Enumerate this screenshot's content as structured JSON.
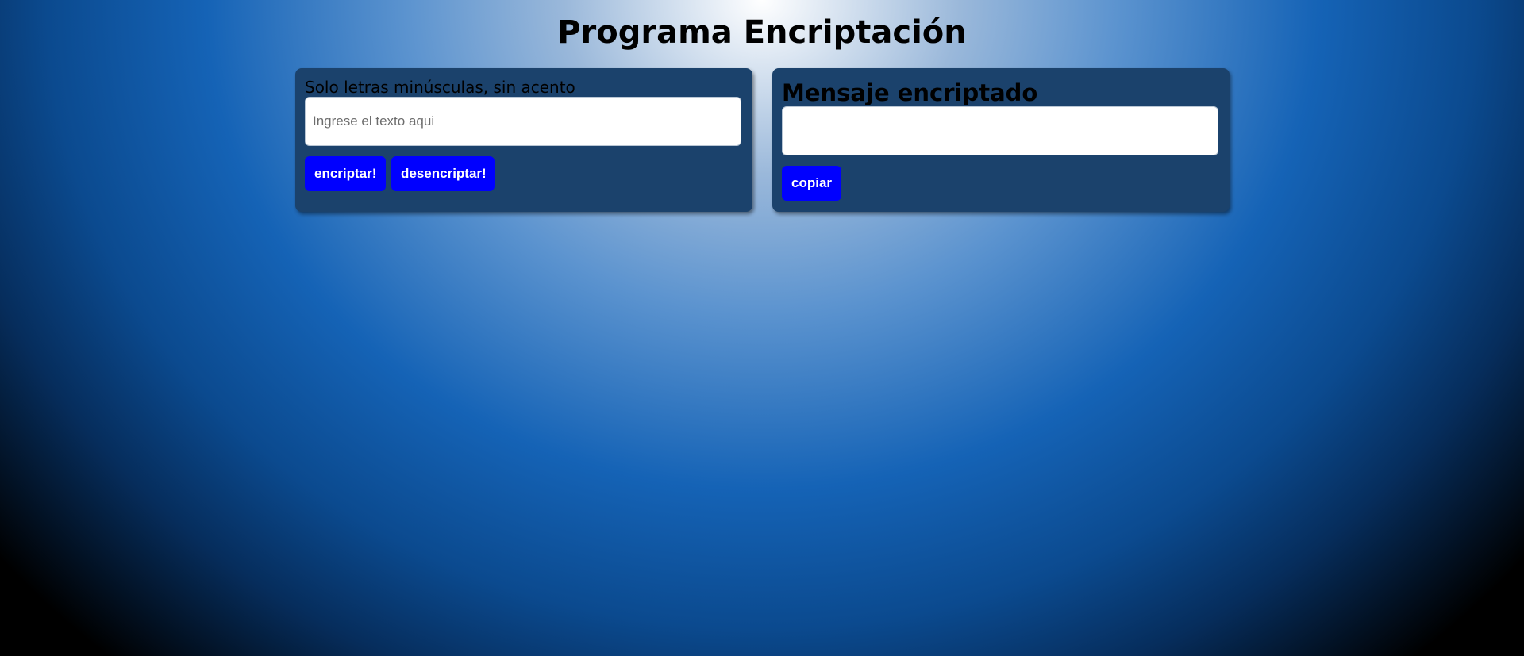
{
  "header": {
    "title": "Programa Encriptación"
  },
  "input_panel": {
    "instruction": "Solo letras minúsculas, sin acento",
    "input_placeholder": "Ingrese el texto aqui",
    "input_value": "",
    "encrypt_label": "encriptar!",
    "decrypt_label": "desencriptar!"
  },
  "output_panel": {
    "heading": "Mensaje encriptado",
    "output_value": "",
    "copy_label": "copiar"
  },
  "colors": {
    "panel_background": "#1b426c",
    "button_background": "#0000ff",
    "button_text": "#ffffff"
  }
}
